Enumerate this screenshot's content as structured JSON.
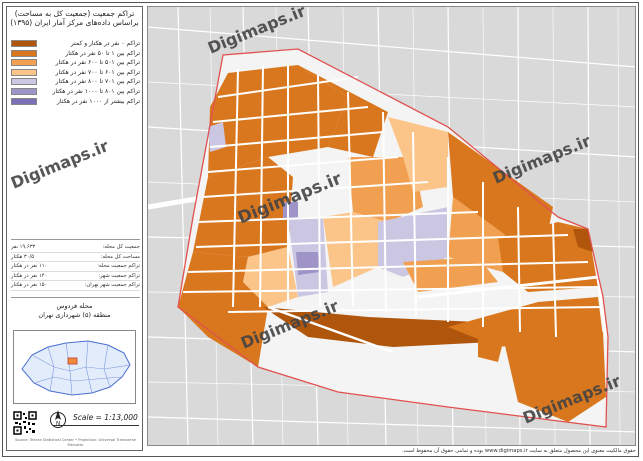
{
  "panel": {
    "title_line1": "تراکم جمعیت (جمعیت کل به مساحت)",
    "title_line2": "براساس داده‌های مرکز آمار ایران (۱۳۹۵)"
  },
  "legend": [
    {
      "label": "تراکم ۰ نفر در هکتار و کمتر",
      "color": "#b0560c"
    },
    {
      "label": "تراکم بین ۱ تا ۵۰ نفر در هکتار",
      "color": "#d9771e"
    },
    {
      "label": "تراکم بین ۵۰۱ تا ۶۰۰ نفر در هکتار",
      "color": "#f0a050"
    },
    {
      "label": "تراکم بین ۶۰۱ تا ۷۰۰ نفر در هکتار",
      "color": "#fbc58a"
    },
    {
      "label": "تراکم بین ۷۰۱ تا ۸۰۰ نفر در هکتار",
      "color": "#cbc7e3"
    },
    {
      "label": "تراکم بین ۸۰۱ تا ۱۰۰۰ نفر در هکتار",
      "color": "#9f94c8"
    },
    {
      "label": "تراکم بیشتر از ۱۰۰۰ نفر در هکتار",
      "color": "#7d6fb7"
    }
  ],
  "stats": [
    {
      "label": "جمعیت کل محله:",
      "value": "۱۹,۶۳۳ نفر"
    },
    {
      "label": "مساحت کل محله:",
      "value": "۳۰/۵ هکتار"
    },
    {
      "label": "تراکم جمعیت محله:",
      "value": "۱۱۰ نفر در هکتار"
    },
    {
      "label": "تراکم جمعیت شهر:",
      "value": "۱۴۰ نفر در هکتار"
    },
    {
      "label": "تراکم جمعیت شهر تهران:",
      "value": "۱۵۰ نفر در هکتار"
    }
  ],
  "region": {
    "line1": "محله فردوس",
    "line2": "منطقه (۵) شهرداری تهران"
  },
  "scale_label": "Scale = 1:13,000",
  "north_label": "N",
  "footer_note": "Source: Tehran Statistical Center • Projection: Universal Transverse Mercator",
  "copyright": "حقوق مالکیت معنوی این محصول متعلق به سایت www.digimaps.ir بوده و تمامی حقوق آن محفوظ است.",
  "watermark_text": "Digimaps.ir",
  "colors": {
    "boundary": "#e0514f",
    "road": "#ffffff",
    "basemap": "#d9d9d9",
    "block_dark": "#b0560c",
    "block_mid": "#d9771e",
    "block_light": "#f0a050",
    "block_pale": "#fbc58a",
    "block_lav": "#cbc7e3",
    "block_purple": "#9f94c8"
  }
}
